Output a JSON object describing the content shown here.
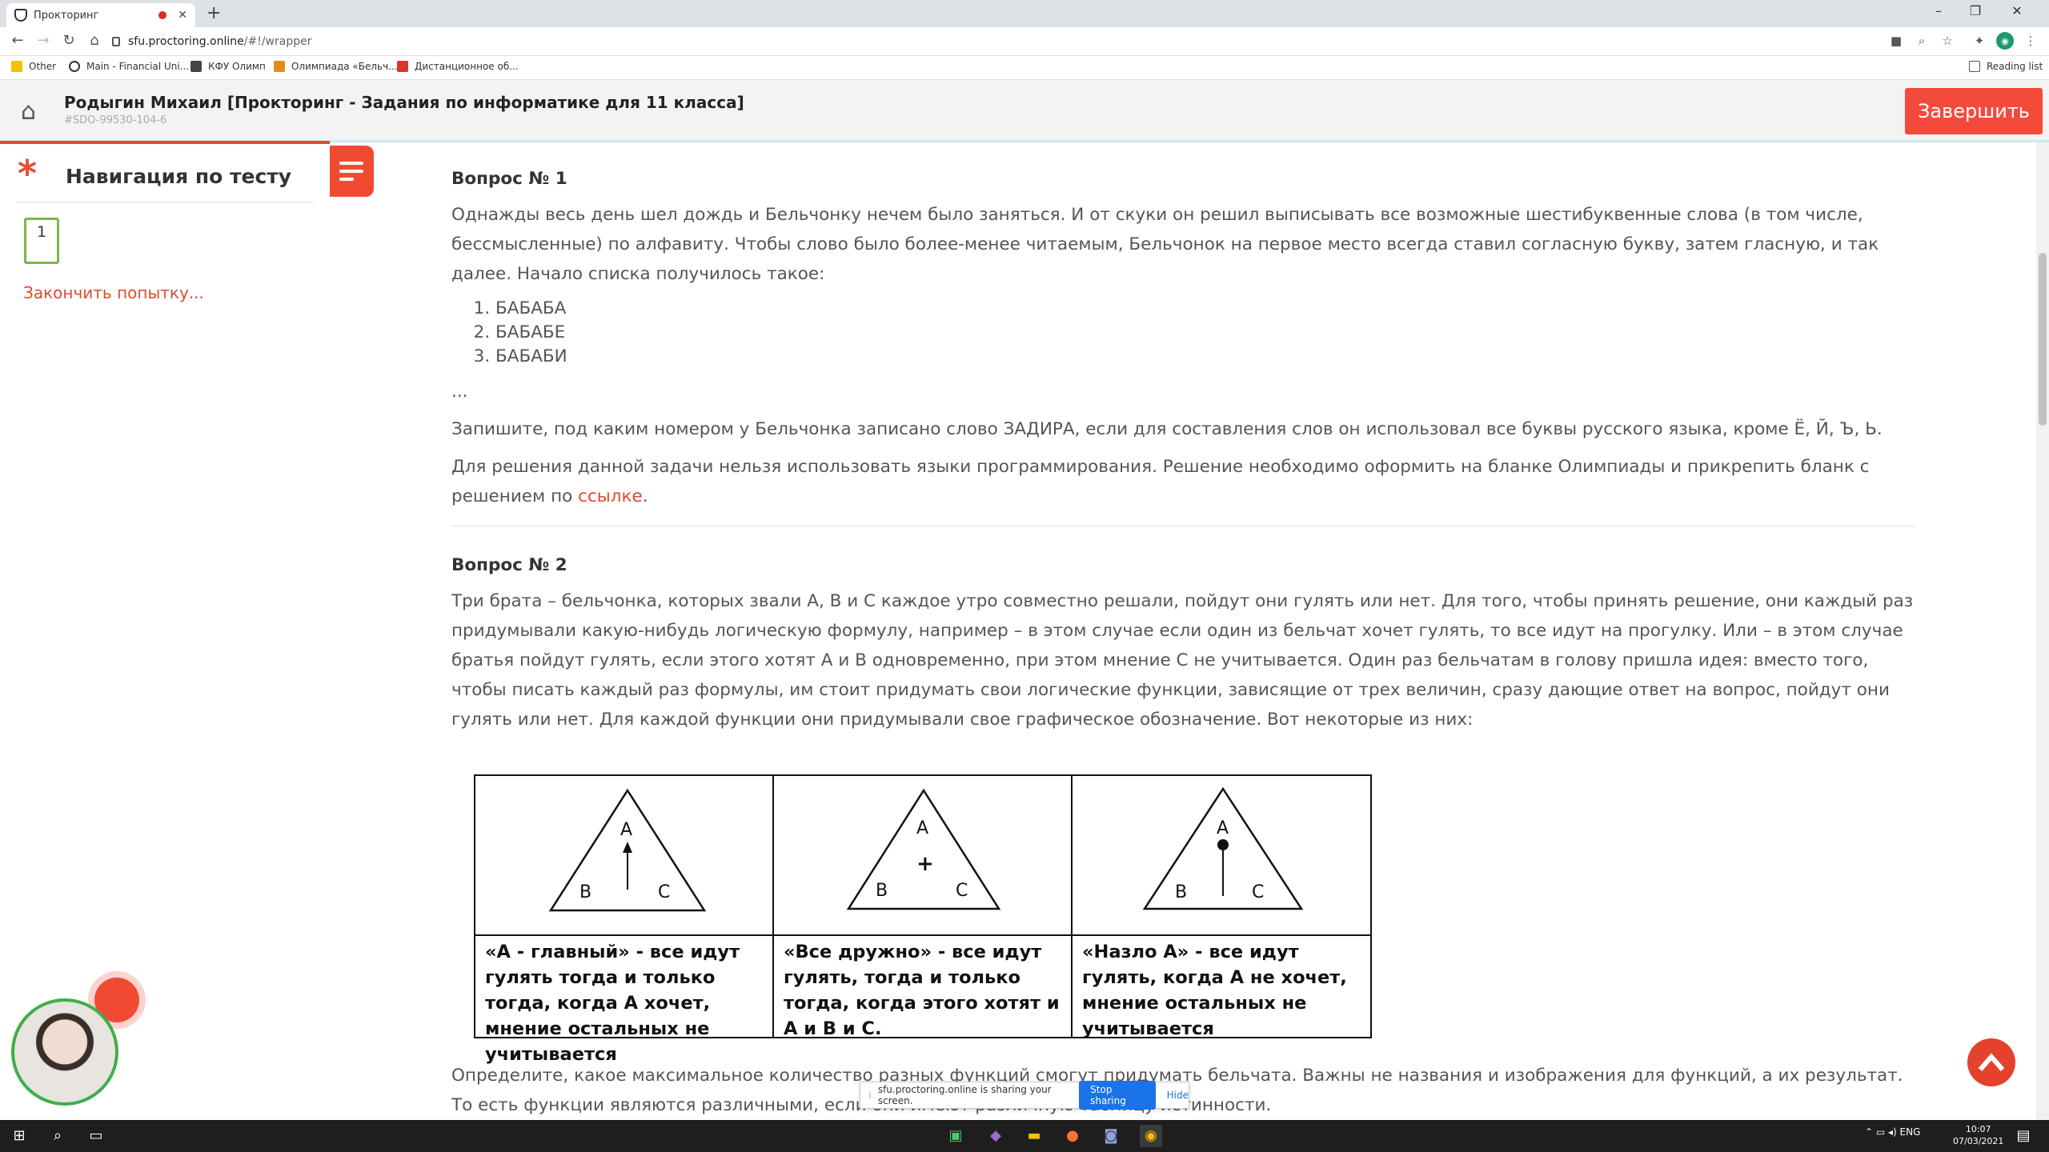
{
  "browser": {
    "tab_title": "Прокторинг",
    "url_host": "sfu.proctoring.online",
    "url_path": "/#!/wrapper",
    "bookmarks": [
      "Other",
      "Main - Financial Uni...",
      "КФУ Олимп",
      "Олимпиада «Бельч...",
      "Дистанционное об..."
    ],
    "reading_list": "Reading list"
  },
  "app": {
    "title": "Родыгин Михаил [Прокторинг - Задания по информатике для 11 класса]",
    "subtitle": "#SDO-99530-104-6",
    "finish_button": "Завершить"
  },
  "sidebar": {
    "title": "Навигация по тесту",
    "question_number": "1",
    "finish_attempt": "Закончить попытку..."
  },
  "q1": {
    "heading": "Вопрос № 1",
    "p1": "Однажды весь день шел дождь и Бельчонку нечем было заняться. И от скуки он решил выписывать все возможные шестибуквенные слова (в том числе, бессмысленные) по алфавиту. Чтобы слово было более-менее читаемым, Бельчонок на первое место всегда ставил согласную букву, затем гласную, и так далее. Начало списка получилось такое:",
    "list": [
      "БАБАБА",
      "БАБАБЕ",
      "БАБАБИ"
    ],
    "ellipsis": "...",
    "p2": "Запишите, под каким номером у Бельчонка записано слово ЗАДИРА, если для составления слов он использовал все буквы русского языка, кроме Ё, Й, Ъ, Ь.",
    "p3": "Для решения данной задачи нельзя использовать языки программирования. Решение необходимо оформить на бланке Олимпиады и прикрепить бланк с решением по ",
    "link": "ссылке",
    "p3_end": "."
  },
  "q2": {
    "heading": "Вопрос № 2",
    "p1": "Три брата – бельчонка, которых звали A, B и C каждое утро совместно решали, пойдут они гулять или нет. Для того, чтобы принять решение, они каждый раз придумывали какую-нибудь логическую формулу, например  – в этом случае если один из бельчат хочет гулять, то все идут на прогулку. Или  – в этом случае братья пойдут гулять, если этого хотят A и B одновременно, при этом мнение C не учитывается. Один раз бельчатам в голову пришла идея: вместо того, чтобы писать каждый раз формулы, им стоит придумать свои логические функции, зависящие от трех величин, сразу дающие ответ на вопрос, пойдут они гулять или нет. Для каждой функции они придумывали свое графическое обозначение. Вот некоторые из них:",
    "figure": {
      "labels": {
        "a": "A",
        "b": "B",
        "c": "C",
        "plus": "+"
      },
      "captions": [
        "«A - главный» - все идут гулять тогда и только тогда, когда A хочет, мнение остальных не учитывается",
        "«Все дружно» - все идут гулять, тогда и только тогда, когда этого хотят и A и B и C.",
        "«Назло A» - все идут гулять, когда A не хочет, мнение остальных не учитывается"
      ]
    },
    "p2": "Определите, какое максимальное количество разных функций смогут придумать бельчата. Важны не названия и изображения для функций, а их результат. То есть функции являются различными, если они имеют различную таблицу истинности."
  },
  "share_bar": {
    "text": "sfu.proctoring.online is sharing your screen.",
    "stop": "Stop sharing",
    "hide": "Hide"
  },
  "taskbar": {
    "lang": "ENG",
    "time": "10:07",
    "date": "07/03/2021"
  }
}
